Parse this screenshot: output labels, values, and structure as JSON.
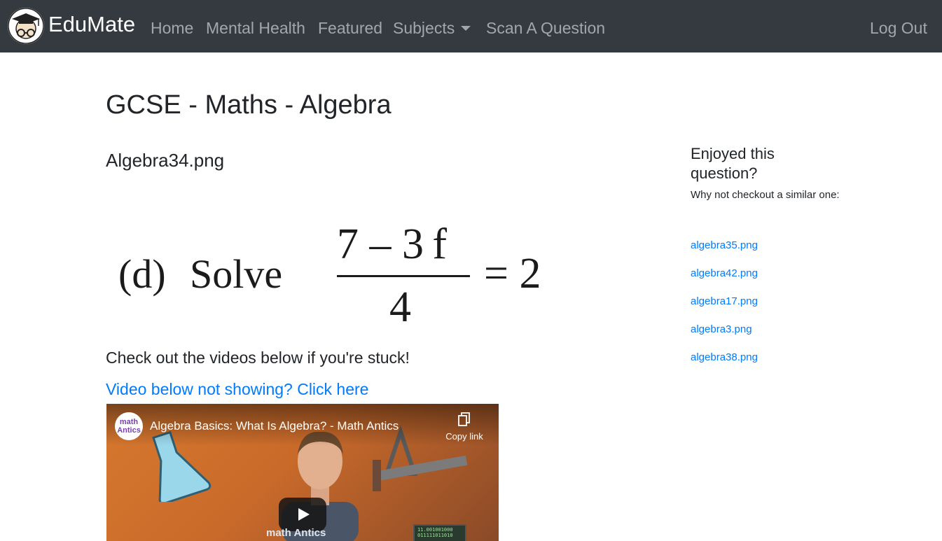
{
  "navbar": {
    "brand": "EduMate",
    "links": {
      "home": "Home",
      "mental_health": "Mental Health",
      "featured": "Featured",
      "subjects": "Subjects",
      "scan": "Scan A Question"
    },
    "logout": "Log Out",
    "bg_color": "#343a40"
  },
  "main": {
    "page_title": "GCSE - Maths - Algebra",
    "question_name": "Algebra34.png",
    "question_image": {
      "label": "(d)",
      "verb": "Solve",
      "numerator": "7 – 3 f",
      "denominator": "4",
      "rhs": "= 2"
    },
    "stuck_text": "Check out the videos below if you're stuck!",
    "video_link": "Video below not showing? Click here",
    "video": {
      "channel": "math Antics",
      "title": "Algebra Basics: What Is Algebra? - Math Antics",
      "copy_link": "Copy link",
      "shirt_text": "math Antics",
      "binary_text": "11.001001000 011111011010"
    }
  },
  "sidebar": {
    "heading": "Enjoyed this question?",
    "subheading": "Why not checkout a similar one:",
    "links": [
      "algebra35.png",
      "algebra42.png",
      "algebra17.png",
      "algebra3.png",
      "algebra38.png"
    ]
  },
  "colors": {
    "link": "#007bff",
    "text": "#212529"
  }
}
